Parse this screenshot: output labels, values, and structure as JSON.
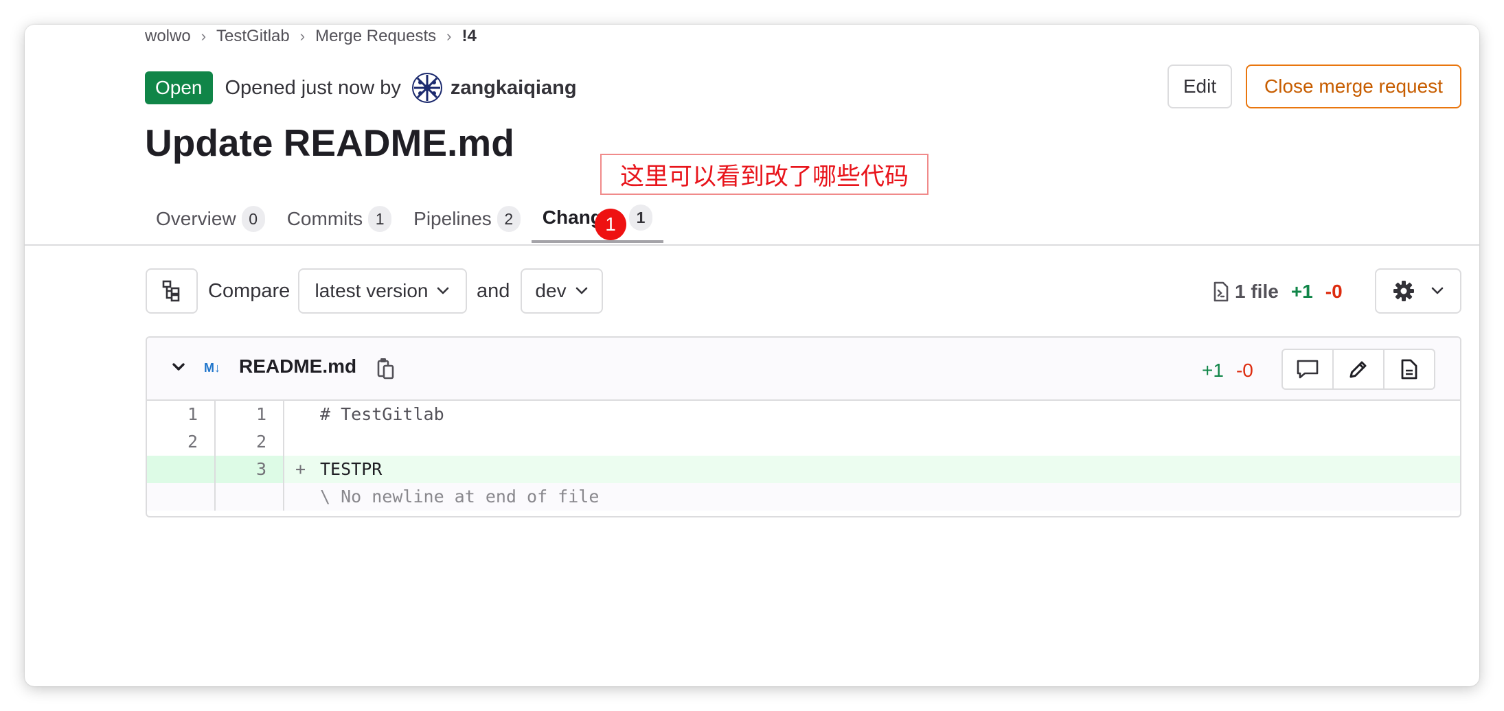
{
  "breadcrumb": {
    "items": [
      "wolwo",
      "TestGitlab",
      "Merge Requests"
    ],
    "current": "!4",
    "separator": "›"
  },
  "merge_request": {
    "status": "Open",
    "opened_text": "Opened just now by",
    "author": "zangkaiqiang",
    "title": "Update README.md",
    "edit_label": "Edit",
    "close_label": "Close merge request"
  },
  "tabs": [
    {
      "label": "Overview",
      "count": "0"
    },
    {
      "label": "Commits",
      "count": "1"
    },
    {
      "label": "Pipelines",
      "count": "2"
    },
    {
      "label": "Changes",
      "count": "1"
    }
  ],
  "annotation": {
    "callout_text": "这里可以看到改了哪些代码",
    "marker_number": "1"
  },
  "compare_bar": {
    "compare_label": "Compare",
    "version_select": "latest version",
    "and_label": "and",
    "target_branch": "dev",
    "file_count_text": "1 file",
    "additions": "+1",
    "deletions": "-0"
  },
  "file": {
    "type_badge": "M↓",
    "name": "README.md",
    "additions": "+1",
    "deletions": "-0",
    "lines": [
      {
        "old": "1",
        "new": "1",
        "sign": "",
        "text": "# TestGitlab",
        "kind": "context"
      },
      {
        "old": "2",
        "new": "2",
        "sign": "",
        "text": "",
        "kind": "context"
      },
      {
        "old": "",
        "new": "3",
        "sign": "+",
        "text": "TESTPR",
        "kind": "added"
      },
      {
        "old": "",
        "new": "",
        "sign": "",
        "text": "\\ No newline at end of file",
        "kind": "note"
      }
    ]
  },
  "colors": {
    "open_badge": "#108548",
    "close_button": "#c75d00",
    "addition": "#108548",
    "deletion": "#dd2b0e",
    "annotation_red": "#e8141b"
  }
}
